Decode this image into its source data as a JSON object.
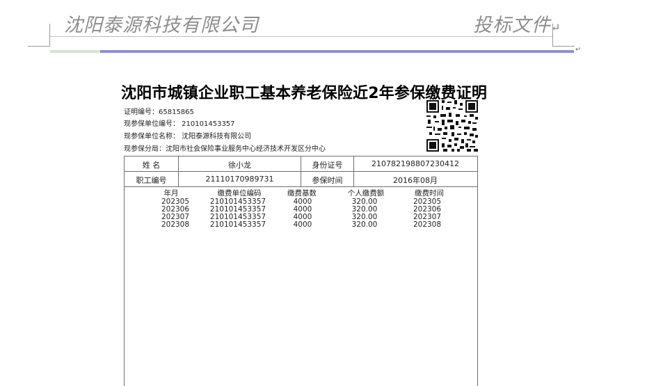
{
  "header": {
    "company": "沈阳泰源科技有限公司",
    "doc_type": "投标文件",
    "return_mark": "↵"
  },
  "certificate": {
    "title": "沈阳市城镇企业职工基本养老保险近2年参保缴费证明",
    "cert_no": "证明编号：65815865",
    "unit_code": "现参保单位编号： 210101453357",
    "unit_name": "现参保单位名称： 沈阳泰源科技有限公司",
    "branch": "现参保分局：沈阳市社会保险事业服务中心经济技术开发区分中心",
    "person": {
      "name_label": "姓  名",
      "name": "徐小龙",
      "id_label": "身份证号",
      "id_no": "210782198807230412",
      "emp_label": "职工编号",
      "emp_no": "21110170989731",
      "join_label": "参保时间",
      "join_date": "2016年08月"
    },
    "columns": [
      "年月",
      "缴费单位编码",
      "缴费基数",
      "个人缴费额",
      "缴费时间"
    ],
    "rows": [
      [
        "202305",
        "210101453357",
        "4000",
        "320.00",
        "202305"
      ],
      [
        "202306",
        "210101453357",
        "4000",
        "320.00",
        "202306"
      ],
      [
        "202307",
        "210101453357",
        "4000",
        "320.00",
        "202307"
      ],
      [
        "202308",
        "210101453357",
        "4000",
        "320.00",
        "202308"
      ]
    ]
  }
}
